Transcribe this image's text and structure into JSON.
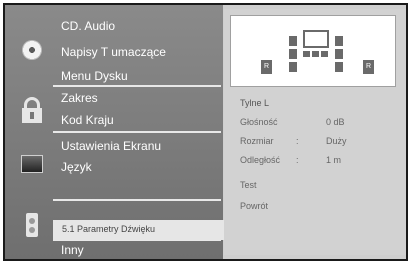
{
  "menu": {
    "groups": [
      {
        "icon": "disc-icon",
        "items": [
          "CD. Audio",
          "Napisy T umaczące",
          "Menu Dysku"
        ]
      },
      {
        "icon": "lock-icon",
        "items": [
          "Zakres",
          "Kod Kraju"
        ]
      },
      {
        "icon": "screen-icon",
        "items": [
          "Ustawienia Ekranu",
          "Język"
        ]
      },
      {
        "icon": "speaker-icon",
        "selected": "5.1 Parametry Dźwięku",
        "items": [
          "Inny"
        ]
      }
    ]
  },
  "panel": {
    "speaker_labels": {
      "left": "R",
      "right": "R"
    },
    "title": "Tylne L",
    "rows": [
      {
        "label": "Głośność",
        "sep": ":",
        "value": "0 dB"
      },
      {
        "label": "Rozmiar",
        "sep": ":",
        "value": "Duży"
      },
      {
        "label": "Odległość",
        "sep": ":",
        "value": "1 m"
      }
    ],
    "test": "Test",
    "back": "Powrót"
  }
}
